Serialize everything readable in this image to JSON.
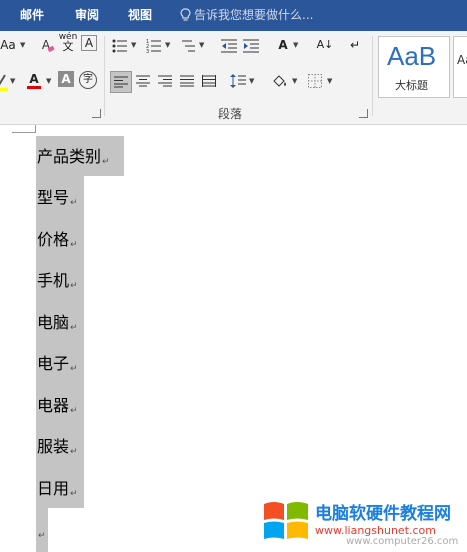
{
  "tabs": [
    {
      "label": "邮件"
    },
    {
      "label": "审阅"
    },
    {
      "label": "视图"
    }
  ],
  "tell_me": {
    "text": "告诉我您想要做什么..."
  },
  "ribbon": {
    "font": {
      "change_case": "Aa",
      "clear_format": "A",
      "phonetic_top": "wén",
      "phonetic_bottom": "文",
      "char_border": "A",
      "font_color": "A",
      "char_shading": "A",
      "enclose_char": "字"
    },
    "paragraph": {
      "group_label": "段落",
      "asian_layout": "A",
      "sort": "A↓",
      "show_marks": "↵"
    },
    "styles": {
      "preview": "AaB",
      "name": "大标题",
      "next_preview": "Aa"
    }
  },
  "document": {
    "lines": [
      {
        "text": "产品类别"
      },
      {
        "text": "型号"
      },
      {
        "text": "价格"
      },
      {
        "text": "手机"
      },
      {
        "text": "电脑"
      },
      {
        "text": "电子"
      },
      {
        "text": "电器"
      },
      {
        "text": "服装"
      },
      {
        "text": "日用"
      }
    ],
    "paragraph_mark": "↵"
  },
  "watermark": {
    "title": "电脑软硬件教程网",
    "url": "www.liangshunet.com",
    "url2": "www.computer26.com"
  },
  "colors": {
    "tab_bar": "#2b579a",
    "selection": "#c4c4c4",
    "font_color_red": "#e00000",
    "highlight_yellow": "#ffff00"
  }
}
